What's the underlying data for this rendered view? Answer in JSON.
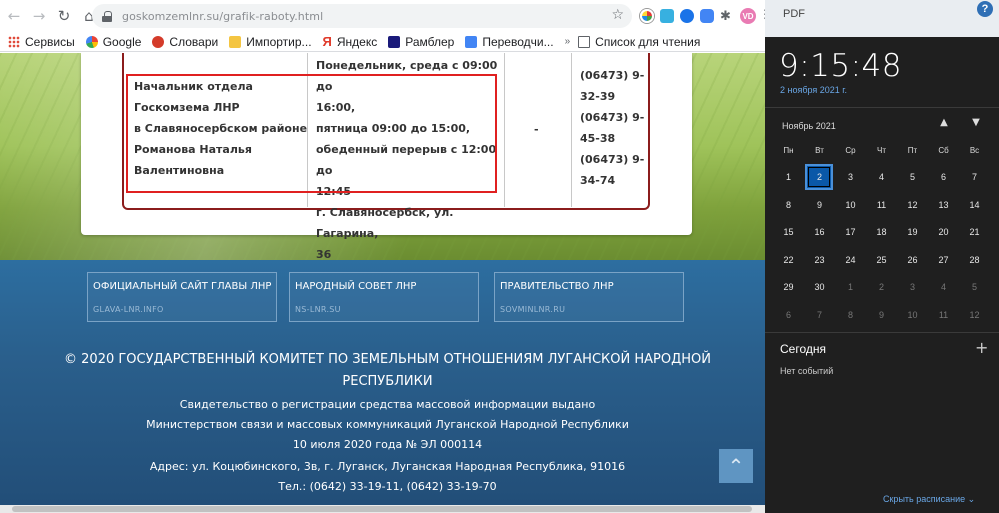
{
  "browser": {
    "url": "goskomzemlnr.su/grafik-raboty.html",
    "nav": {
      "back": "←",
      "forward": "→",
      "reload": "↻",
      "home": "⌂"
    },
    "star_icon": "☆",
    "puzzle_icon": "✱",
    "avatar_initials": "VD",
    "menu_icon": "⋮",
    "bookmarks": [
      {
        "label": "Сервисы",
        "icon": "apps-icon"
      },
      {
        "label": "Google",
        "icon": "google-icon"
      },
      {
        "label": "Словари",
        "icon": "dictionary-icon"
      },
      {
        "label": "Импортир...",
        "icon": "folder-icon"
      },
      {
        "label": "Яндекс",
        "icon": "yandex-icon"
      },
      {
        "label": "Рамблер",
        "icon": "rambler-icon"
      },
      {
        "label": "Переводчи...",
        "icon": "translate-icon"
      },
      {
        "label": "Список для чтения",
        "icon": "reading-list-icon"
      }
    ],
    "bookmarks_more": "»"
  },
  "table": {
    "name_lines": [
      "Начальник отдела",
      "Госкомзема ЛНР",
      "в Славяносербском районе",
      "Романова Наталья",
      "Валентиновна"
    ],
    "schedule_lines": [
      "Понедельник, среда с 09:00 до",
      "16:00,",
      "пятница 09:00 до 15:00,",
      "обеденный перерыв с 12:00 до",
      "12:45",
      "г. Славяносербск, ул. Гагарина,",
      "36"
    ],
    "dash": "-",
    "phone_lines": [
      "(06473) 9-",
      "32-39",
      "(06473) 9-",
      "45-38",
      "(06473) 9-",
      "34-74"
    ]
  },
  "footer": {
    "links": [
      {
        "title": "ОФИЦИАЛЬНЫЙ САЙТ ГЛАВЫ ЛНР",
        "sub": "GLAVA-LNR.INFO"
      },
      {
        "title": "НАРОДНЫЙ СОВЕТ ЛНР",
        "sub": "NS-LNR.SU"
      },
      {
        "title": "ПРАВИТЕЛЬСТВО ЛНР",
        "sub": "SOVMINLNR.RU"
      }
    ],
    "copyright_1": "© 2020 ГОСУДАРСТВЕННЫЙ КОМИТЕТ ПО ЗЕМЕЛЬНЫМ ОТНОШЕНИЯМ ЛУГАНСКОЙ НАРОДНОЙ",
    "copyright_2": "РЕСПУБЛИКИ",
    "line_1": "Свидетельство о регистрации средства массовой информации выдано",
    "line_2": "Министерством связи и массовых коммуникаций Луганской Народной Республики",
    "line_3": "10 июля 2020 года № ЭЛ 000114",
    "line_4": "Адрес: ул. Коцюбинского, 3в, г. Луганск, Луганская Народная Республика, 91016",
    "line_5": "Тел.: (0642) 33-19-11, (0642) 33-19-70",
    "to_top_icon": "⌃"
  },
  "behind_window": {
    "text": "PDF",
    "help": "?"
  },
  "calendar": {
    "time": "9:15:48",
    "date": "2 ноября 2021 г.",
    "month": "Ноябрь 2021",
    "prev_icon": "▲",
    "next_icon": "▼",
    "weekdays": [
      "Пн",
      "Вт",
      "Ср",
      "Чт",
      "Пт",
      "Сб",
      "Вс"
    ],
    "weeks": [
      [
        "1",
        "2",
        "3",
        "4",
        "5",
        "6",
        "7"
      ],
      [
        "8",
        "9",
        "10",
        "11",
        "12",
        "13",
        "14"
      ],
      [
        "15",
        "16",
        "17",
        "18",
        "19",
        "20",
        "21"
      ],
      [
        "22",
        "23",
        "24",
        "25",
        "26",
        "27",
        "28"
      ],
      [
        "29",
        "30",
        "1",
        "2",
        "3",
        "4",
        "5"
      ],
      [
        "6",
        "7",
        "8",
        "9",
        "10",
        "11",
        "12"
      ]
    ],
    "today": "Сегодня",
    "add_icon": "+",
    "no_events": "Нет событий",
    "hide_schedule": "Скрыть расписание ⌄"
  },
  "colors": {
    "highlight": "#e02020",
    "calendar_bg": "#1f1f1f",
    "today_accent": "#0a58a8",
    "link": "#6aa7e6",
    "footer_bg": "#2a5f8c"
  }
}
